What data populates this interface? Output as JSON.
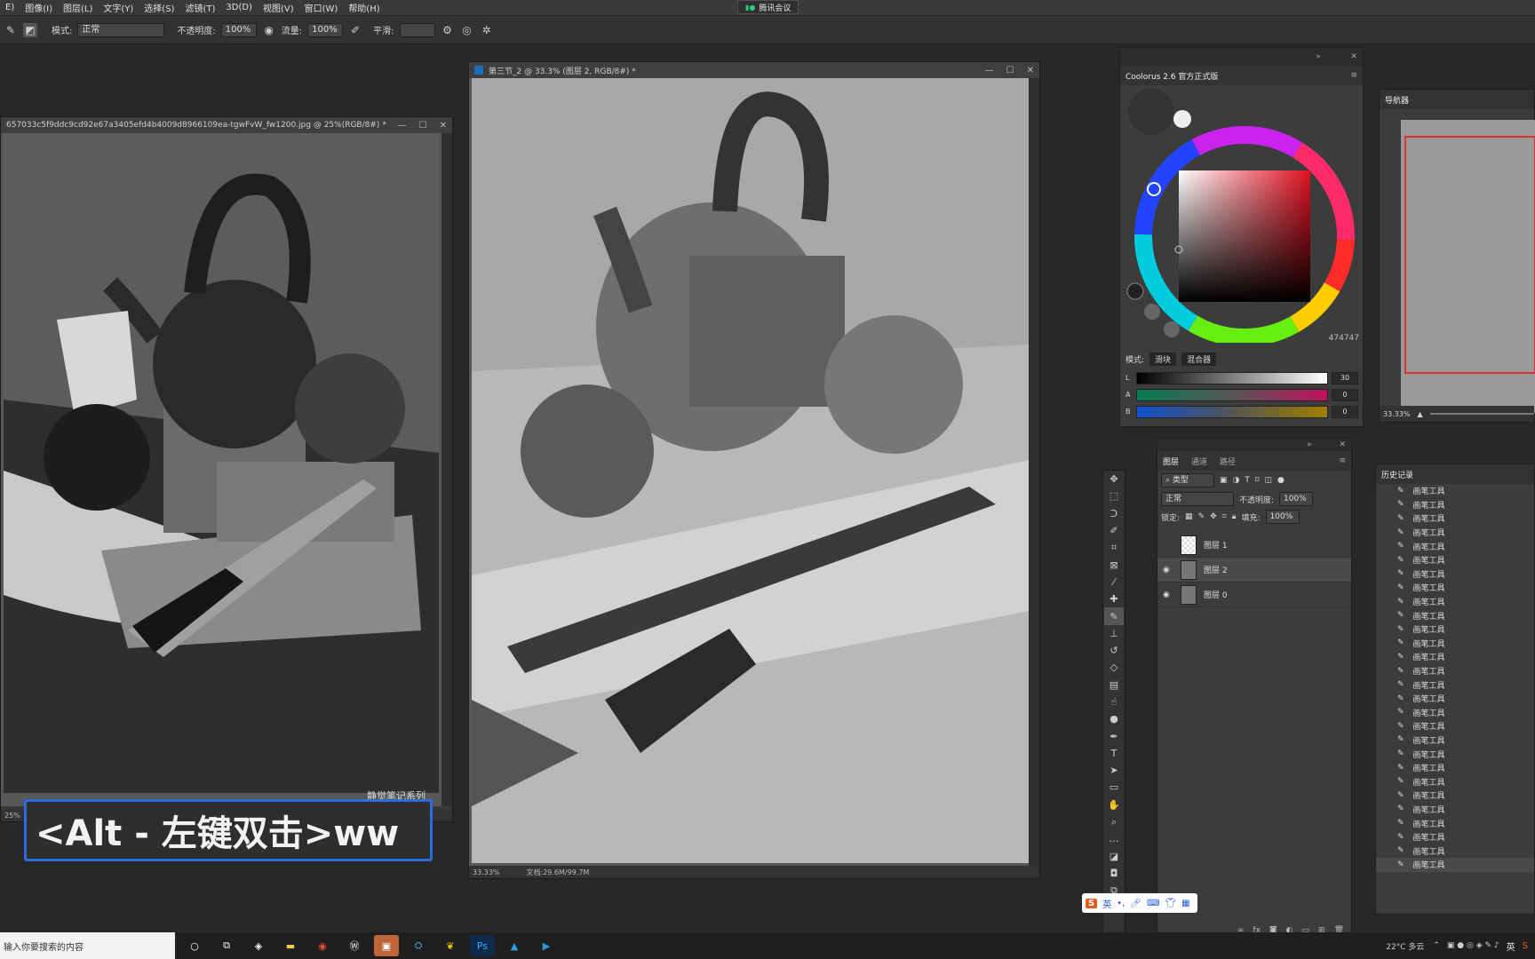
{
  "menubar": {
    "items": [
      "E)",
      "图像(I)",
      "图层(L)",
      "文字(Y)",
      "选择(S)",
      "滤镜(T)",
      "3D(D)",
      "视图(V)",
      "窗口(W)",
      "帮助(H)"
    ],
    "meeting_label": "腾讯会议"
  },
  "options": {
    "mode_label": "模式:",
    "mode_value": "正常",
    "opacity_label": "不透明度:",
    "opacity_value": "100%",
    "flow_label": "流量:",
    "flow_value": "100%",
    "smooth_label": "平滑:"
  },
  "ref_doc": {
    "title": "657033c5f9ddc9cd92e67a3405efd4b4009d8966109ea-tgwFvW_fw1200.jpg @ 25%(RGB/8#) *",
    "zoom": "25%",
    "watermark": "静觉笔记系列"
  },
  "main_doc": {
    "title": "第三节_2 @ 33.3% (图层 2, RGB/8#) *",
    "zoom": "33.33%",
    "doc_info": "文档:29.6M/99.7M"
  },
  "coolorus": {
    "title": "Coolorus 2.6 官方正式版",
    "hex": "474747",
    "mode_label": "模式:",
    "tab_swatch": "滑块",
    "tab_mixer": "混合器",
    "sliders": [
      {
        "label": "L",
        "value": "30"
      },
      {
        "label": "A",
        "value": "0"
      },
      {
        "label": "B",
        "value": "0"
      }
    ]
  },
  "navigator": {
    "title": "导航器",
    "zoom": "33.33%"
  },
  "layers": {
    "tabs": [
      "图层",
      "通道",
      "路径"
    ],
    "filter_label": "类型",
    "blend_mode": "正常",
    "opacity_label": "不透明度:",
    "opacity_value": "100%",
    "lock_label": "锁定:",
    "fill_label": "填充:",
    "fill_value": "100%",
    "rows": [
      {
        "name": "图层 1",
        "visible": false
      },
      {
        "name": "图层 2",
        "visible": true
      },
      {
        "name": "图层 0",
        "visible": true
      }
    ]
  },
  "history": {
    "title": "历史记录",
    "item_label": "画笔工具",
    "count": 28
  },
  "caption": {
    "text": "<Alt - 左键双击>ww"
  },
  "ime": {
    "label": "英"
  },
  "taskbar": {
    "search_placeholder": "输入你要搜索的内容",
    "weather": "22°C 多云",
    "lang": "英"
  }
}
